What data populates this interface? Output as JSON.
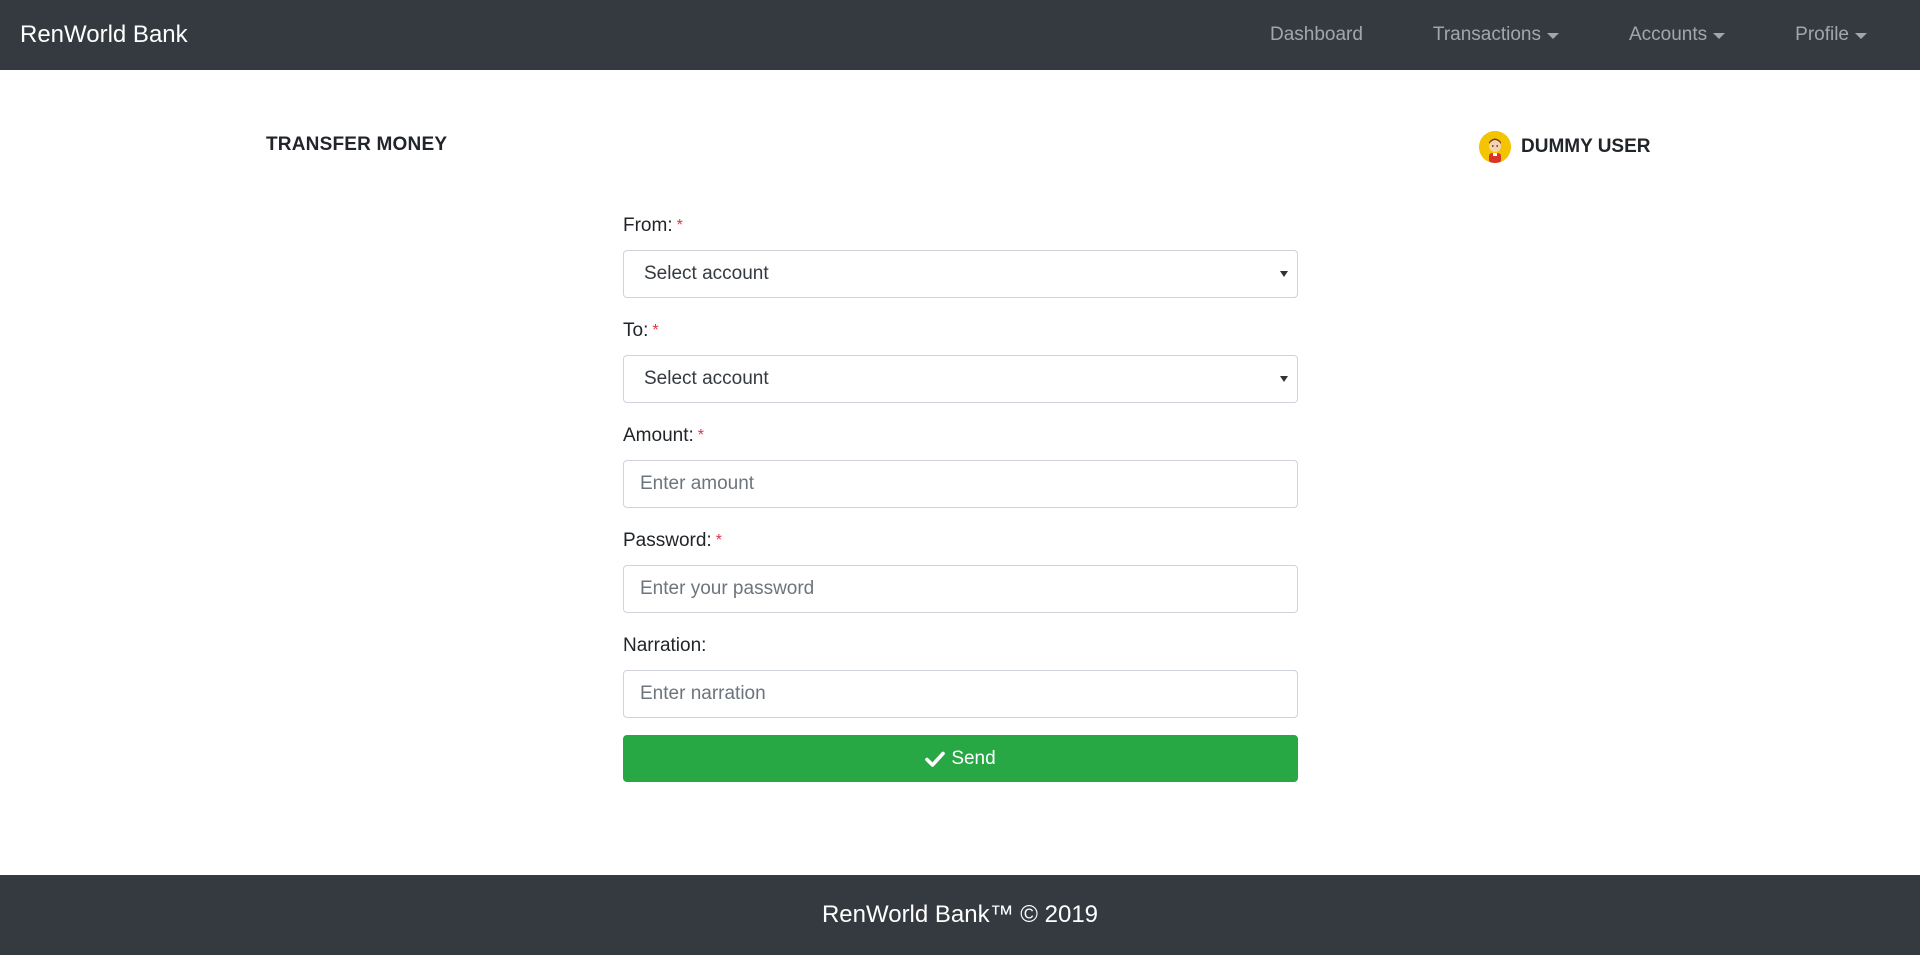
{
  "navbar": {
    "brand": "RenWorld Bank",
    "items": [
      {
        "label": "Dashboard",
        "dropdown": false
      },
      {
        "label": "Transactions",
        "dropdown": true
      },
      {
        "label": "Accounts",
        "dropdown": true
      },
      {
        "label": "Profile",
        "dropdown": true
      }
    ]
  },
  "page": {
    "title": "TRANSFER MONEY",
    "user_name": "DUMMY USER",
    "avatar_icon": "user-avatar-icon"
  },
  "form": {
    "from": {
      "label": "From:",
      "required": "*",
      "value": "Select account"
    },
    "to": {
      "label": "To:",
      "required": "*",
      "value": "Select account"
    },
    "amount": {
      "label": "Amount:",
      "required": "*",
      "placeholder": "Enter amount"
    },
    "password": {
      "label": "Password:",
      "required": "*",
      "placeholder": "Enter your password"
    },
    "narration": {
      "label": "Narration:",
      "placeholder": "Enter narration"
    },
    "send_label": "Send",
    "send_icon": "check-icon"
  },
  "footer": {
    "text": "RenWorld Bank™ © 2019"
  },
  "colors": {
    "navbar_bg": "#343a40",
    "primary_action": "#28a745",
    "required": "#dc3545"
  }
}
